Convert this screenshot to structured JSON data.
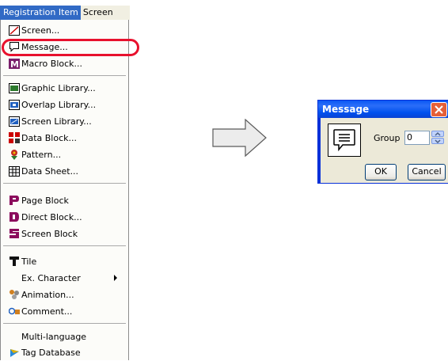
{
  "menubar": {
    "active_title": "Registration Item",
    "next_title": "Screen"
  },
  "menu": {
    "items": [
      {
        "label": "Screen...",
        "icon": "screen-icon"
      },
      {
        "label": "Message...",
        "icon": "message-icon",
        "highlighted": true
      },
      {
        "label": "Macro Block...",
        "icon": "macro-block-icon"
      },
      {
        "label": "Graphic Library...",
        "icon": "graphic-library-icon"
      },
      {
        "label": "Overlap Library...",
        "icon": "overlap-library-icon"
      },
      {
        "label": "Screen Library...",
        "icon": "screen-library-icon"
      },
      {
        "label": "Data Block...",
        "icon": "data-block-icon"
      },
      {
        "label": "Pattern...",
        "icon": "pattern-icon"
      },
      {
        "label": "Data Sheet...",
        "icon": "data-sheet-icon"
      },
      {
        "label": "Page Block",
        "icon": "page-block-icon"
      },
      {
        "label": "Direct Block...",
        "icon": "direct-block-icon"
      },
      {
        "label": "Screen Block",
        "icon": "screen-block-icon"
      },
      {
        "label": "Tile",
        "icon": "tile-icon"
      },
      {
        "label": "Ex. Character",
        "icon": "",
        "submenu": true
      },
      {
        "label": "Animation...",
        "icon": "animation-icon"
      },
      {
        "label": "Comment...",
        "icon": "comment-icon"
      },
      {
        "label": "Multi-language",
        "icon": ""
      },
      {
        "label": "Tag Database",
        "icon": "tag-database-icon"
      }
    ]
  },
  "dialog": {
    "title": "Message",
    "group_label": "Group",
    "group_value": "0",
    "ok_label": "OK",
    "cancel_label": "Cancel"
  },
  "colors": {
    "highlight_ring": "#e8112d",
    "menu_title_bg": "#316ac5",
    "dialog_title_bg": "#0a58f4"
  }
}
